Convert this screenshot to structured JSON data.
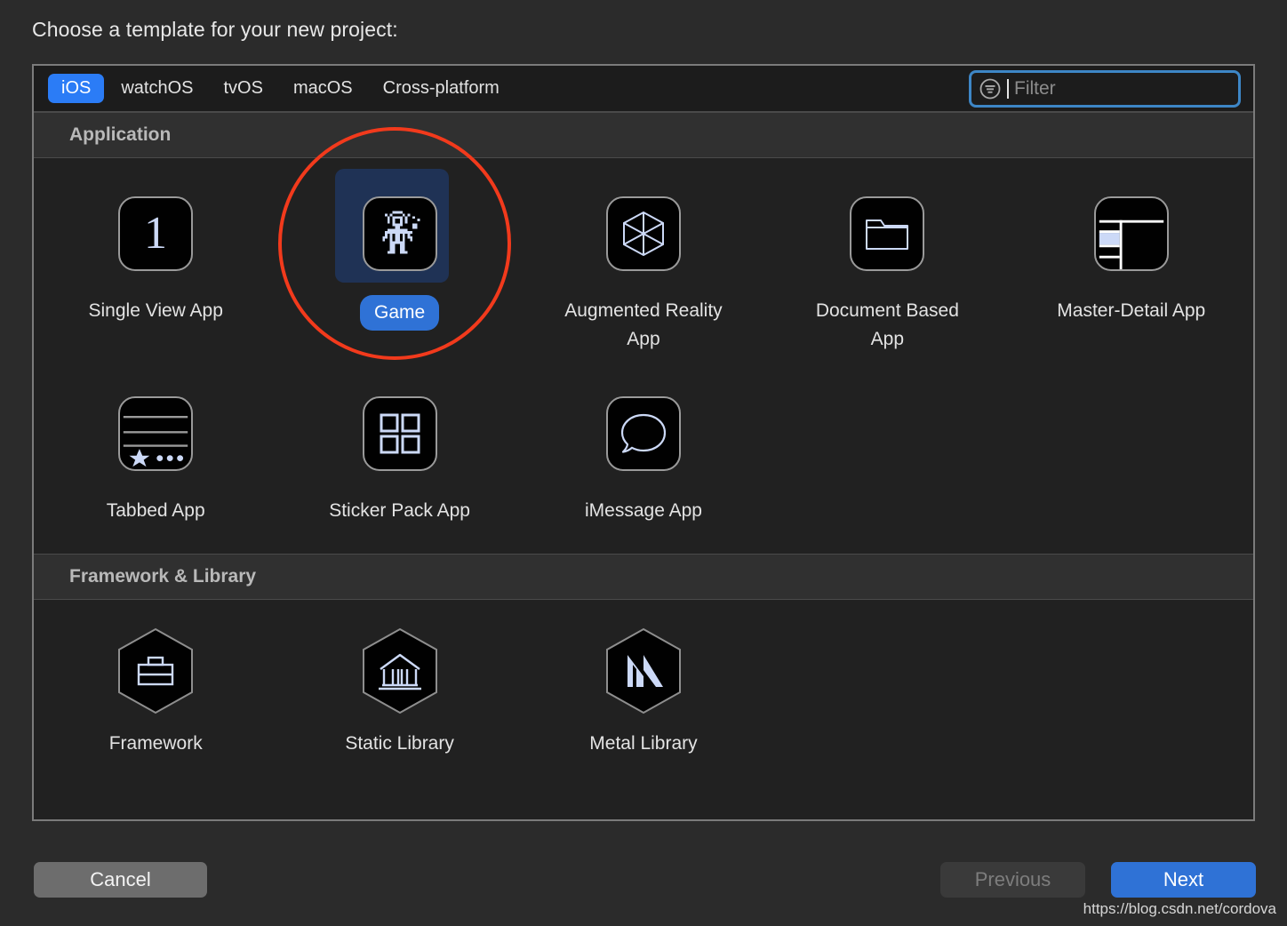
{
  "dialog": {
    "title": "Choose a template for your new project:"
  },
  "tabs": {
    "items": [
      {
        "label": "iOS",
        "active": true
      },
      {
        "label": "watchOS",
        "active": false
      },
      {
        "label": "tvOS",
        "active": false
      },
      {
        "label": "macOS",
        "active": false
      },
      {
        "label": "Cross-platform",
        "active": false
      }
    ]
  },
  "filter": {
    "icon": "filter-icon",
    "placeholder": "Filter",
    "value": "",
    "focused": true,
    "focus_ring_color": "#3d86c6"
  },
  "sections": [
    {
      "header": "Application",
      "items": [
        {
          "label": "Single View App",
          "icon": "number-one-icon",
          "selected": false
        },
        {
          "label": "Game",
          "icon": "pixel-astronaut-icon",
          "selected": true
        },
        {
          "label": "Augmented Reality App",
          "icon": "wireframe-cube-icon",
          "selected": false
        },
        {
          "label": "Document Based App",
          "icon": "folder-icon",
          "selected": false
        },
        {
          "label": "Master-Detail App",
          "icon": "split-view-icon",
          "selected": false
        },
        {
          "label": "Tabbed App",
          "icon": "tab-bar-icon",
          "selected": false
        },
        {
          "label": "Sticker Pack App",
          "icon": "grid-four-icon",
          "selected": false
        },
        {
          "label": "iMessage App",
          "icon": "speech-bubble-icon",
          "selected": false
        }
      ]
    },
    {
      "header": "Framework & Library",
      "items": [
        {
          "label": "Framework",
          "icon": "hexagon-briefcase-icon",
          "selected": false
        },
        {
          "label": "Static Library",
          "icon": "hexagon-bank-icon",
          "selected": false
        },
        {
          "label": "Metal Library",
          "icon": "hexagon-metal-m-icon",
          "selected": false
        }
      ]
    }
  ],
  "footer": {
    "cancel_label": "Cancel",
    "previous_label": "Previous",
    "previous_disabled": true,
    "next_label": "Next",
    "watermark": "https://blog.csdn.net/cordova"
  },
  "colors": {
    "accent_blue": "#2b7cf6",
    "next_blue": "#2f72d6",
    "selection_bg": "#1f3255",
    "annotation_red": "#f23a1c",
    "icon_tint": "#ccd9f7"
  }
}
